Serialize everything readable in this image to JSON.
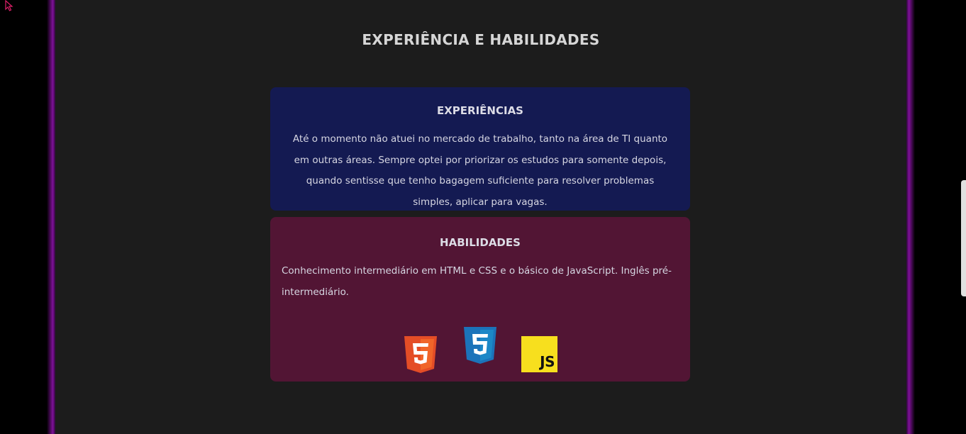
{
  "section": {
    "title": "EXPERIÊNCIA E HABILIDADES"
  },
  "experience": {
    "heading": "EXPERIÊNCIAS",
    "text": "Até o momento não atuei no mercado de trabalho, tanto na área de TI quanto em outras áreas. Sempre optei por priorizar os estudos para somente depois, quando sentisse que tenho bagagem suficiente para resolver problemas simples, aplicar para vagas."
  },
  "skills": {
    "heading": "HABILIDADES",
    "text": "Conhecimento intermediário em HTML e CSS e o básico de JavaScript. Inglês pré-intermediário.",
    "icons": [
      {
        "name": "html5-icon",
        "color": "#e44d26"
      },
      {
        "name": "css3-icon",
        "color": "#1b73ba"
      },
      {
        "name": "javascript-icon",
        "color": "#f7df1e",
        "label": "JS"
      }
    ]
  },
  "colors": {
    "background": "#1c1c1c",
    "experience_card": "#141a52",
    "skills_card": "#521534",
    "glow": "#9614b4"
  }
}
